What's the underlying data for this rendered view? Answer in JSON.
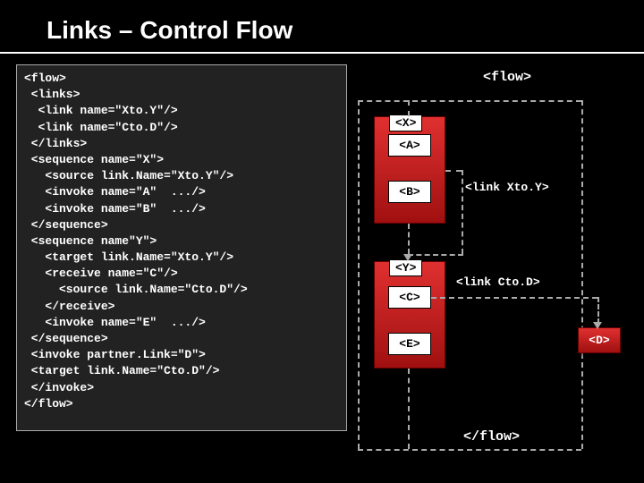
{
  "title": "Links – Control Flow",
  "code": "<flow>\n <links>\n  <link name=\"Xto.Y\"/>\n  <link name=\"Cto.D\"/>\n </links>\n <sequence name=\"X\">\n   <source link.Name=\"Xto.Y\"/>\n   <invoke name=\"A\"  .../>\n   <invoke name=\"B\"  .../>\n </sequence>\n <sequence name\"Y\">\n   <target link.Name=\"Xto.Y\"/>\n   <receive name=\"C\"/>\n     <source link.Name=\"Cto.D\"/>\n   </receive>\n   <invoke name=\"E\"  .../>\n </sequence>\n <invoke partner.Link=\"D\">\n <target link.Name=\"Cto.D\"/>\n </invoke>\n</flow>",
  "diagram": {
    "flow_open": "<flow>",
    "flow_close": "</flow>",
    "seq_x": "<X>",
    "seq_y": "<Y>",
    "act_a": "<A>",
    "act_b": "<B>",
    "act_c": "<C>",
    "act_e": "<E>",
    "act_d": "<D>",
    "link_xtoy": "<link Xto.Y>",
    "link_ctod": "<link Cto.D>"
  }
}
